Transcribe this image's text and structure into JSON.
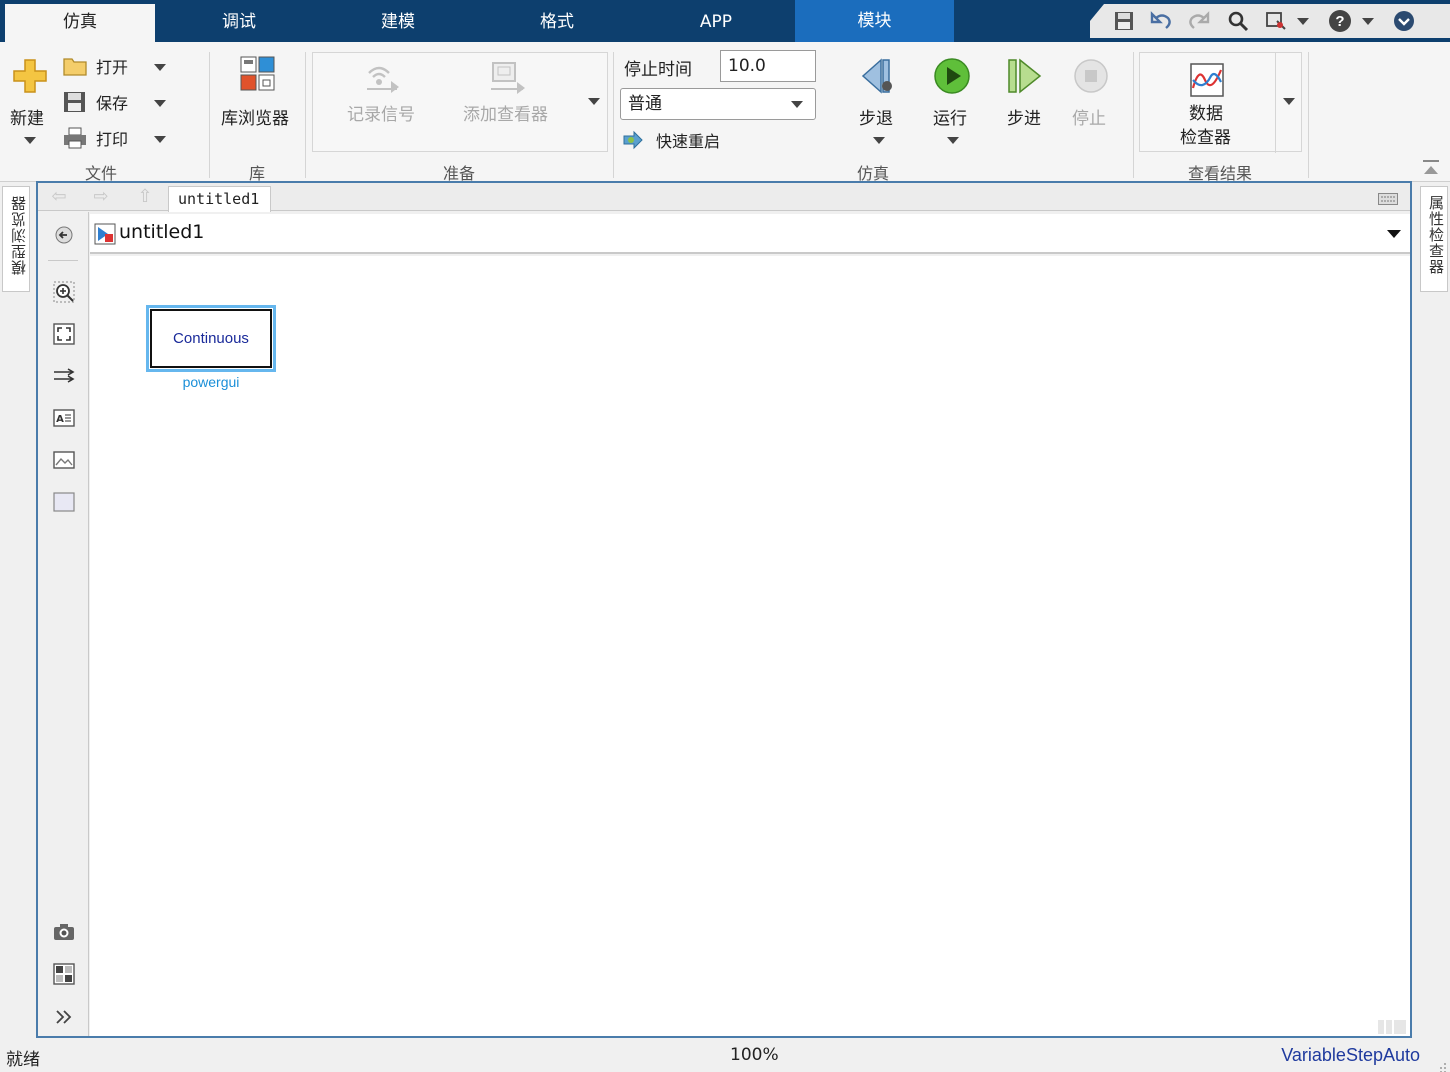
{
  "tabs": [
    {
      "label": "仿真",
      "active": true
    },
    {
      "label": "调试"
    },
    {
      "label": "建模"
    },
    {
      "label": "格式"
    },
    {
      "label": "APP"
    },
    {
      "label": "模块",
      "contextual": true
    }
  ],
  "quick_access": [
    "save-icon",
    "undo-icon",
    "redo-icon",
    "search-icon",
    "pin-icon",
    "help-icon",
    "collapse-icon"
  ],
  "ribbon": {
    "file": {
      "new_label": "新建",
      "open_label": "打开",
      "save_label": "保存",
      "print_label": "打印",
      "group_label": "文件"
    },
    "library": {
      "browser_label": "库浏览器",
      "group_label": "库"
    },
    "prepare": {
      "log_signals_label": "记录信号",
      "add_viewer_label": "添加查看器",
      "group_label": "准备"
    },
    "simulate": {
      "stop_time_label": "停止时间",
      "stop_time_value": "10.0",
      "mode_value": "普通",
      "fast_restart_label": "快速重启",
      "step_back_label": "步退",
      "run_label": "运行",
      "step_forward_label": "步进",
      "stop_label": "停止",
      "group_label": "仿真"
    },
    "review": {
      "data_inspector_line1": "数据",
      "data_inspector_line2": "检查器",
      "group_label": "查看结果"
    }
  },
  "side_panels": {
    "left": "模型浏览器",
    "right": "属性检查器"
  },
  "editor": {
    "tab_label": "untitled1",
    "address": "untitled1"
  },
  "block": {
    "text": "Continuous",
    "name": "powergui"
  },
  "status": {
    "left": "就绪",
    "zoom": "100%",
    "solver": "VariableStepAuto"
  },
  "colors": {
    "tab_bar": "#0d3f6e",
    "contextual_tab": "#1b6dbd",
    "block_selection": "#66b7ee",
    "block_text": "#1a2a9a",
    "block_name": "#1a8fd8",
    "solver_text": "#1f3a9e"
  }
}
